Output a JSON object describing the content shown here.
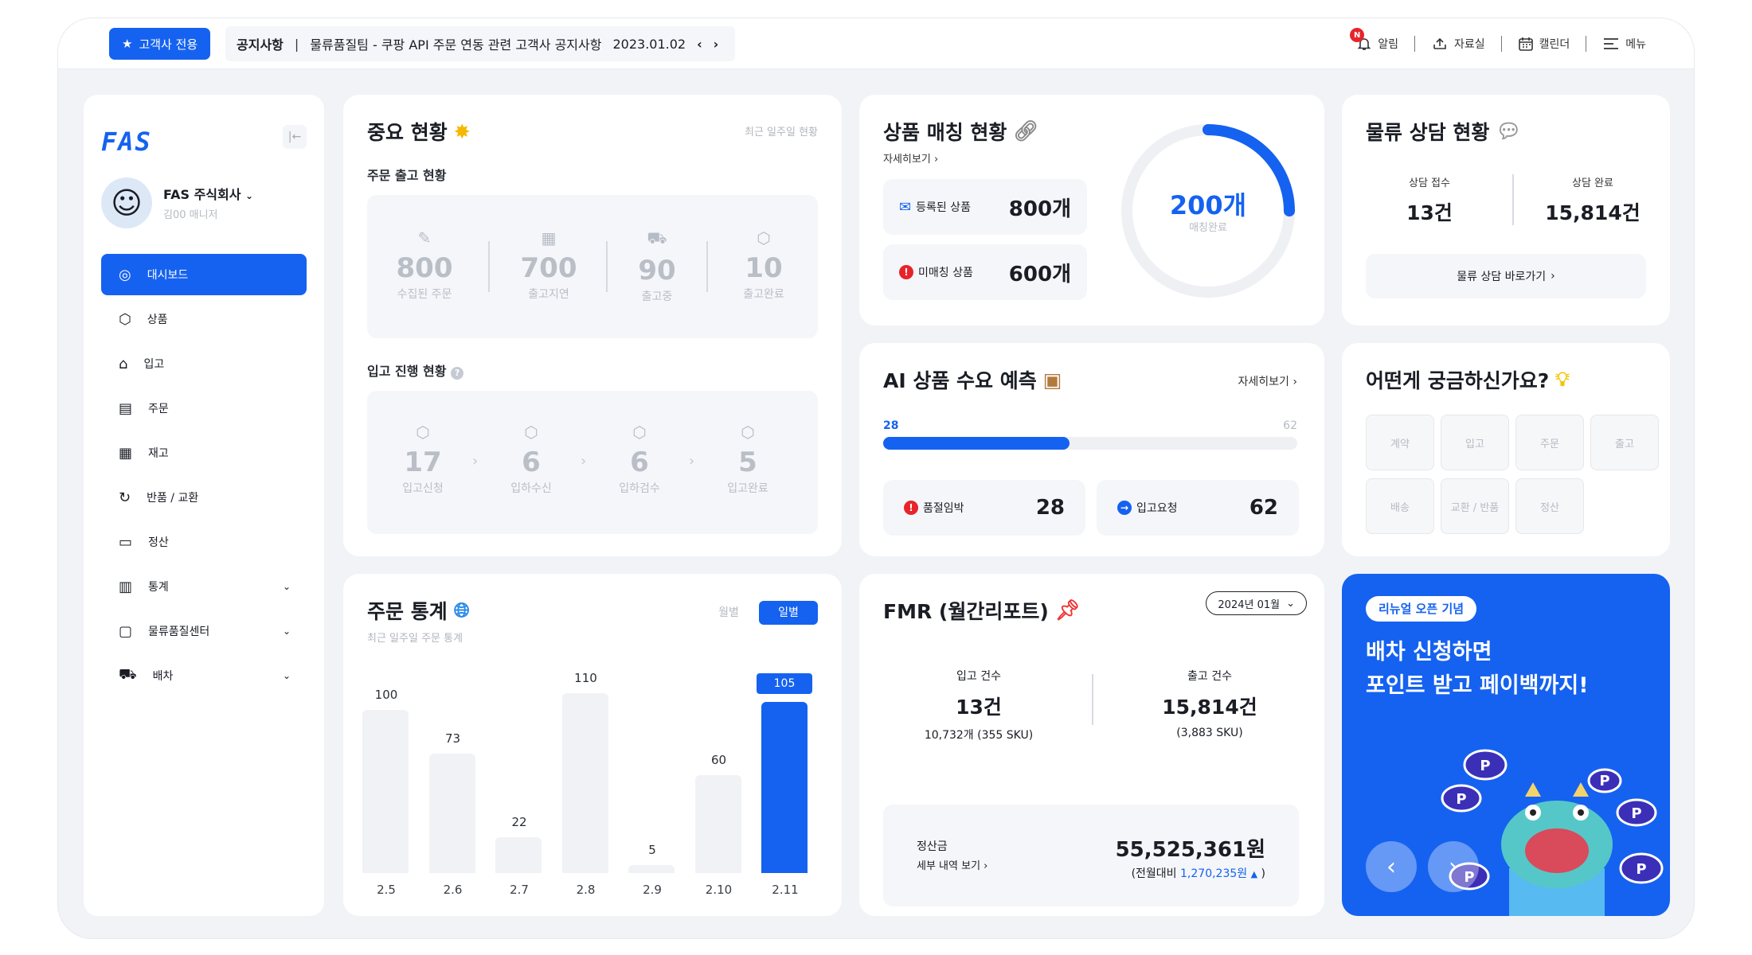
{
  "topbar": {
    "customer_badge": "고객사 전용",
    "notice_label": "공지사항",
    "notice_text": "물류품질팀 - 쿠팡 API 주문 연동 관련 고객사 공지사항",
    "notice_date": "2023.01.02",
    "notif_badge": "N",
    "items": {
      "alarm": "알림",
      "archive": "자료실",
      "calendar": "캘린더",
      "menu": "메뉴"
    }
  },
  "sidebar": {
    "logo": "FAS",
    "company": "FAS 주식회사",
    "user": "김00 매니저",
    "items": [
      {
        "label": "대시보드"
      },
      {
        "label": "상품"
      },
      {
        "label": "입고"
      },
      {
        "label": "주문"
      },
      {
        "label": "재고"
      },
      {
        "label": "반품 / 교환"
      },
      {
        "label": "정산"
      },
      {
        "label": "통계"
      },
      {
        "label": "물류품질센터"
      },
      {
        "label": "배차"
      }
    ]
  },
  "important": {
    "title": "중요 현황",
    "period": "최근 일주일 현황",
    "order_title": "주문 출고 현황",
    "orders": [
      {
        "value": "800",
        "label": "수집된 주문"
      },
      {
        "value": "700",
        "label": "출고지연"
      },
      {
        "value": "90",
        "label": "출고중"
      },
      {
        "value": "10",
        "label": "출고완료"
      }
    ],
    "inbound_title": "입고 진행 현황",
    "inbound": [
      {
        "value": "17",
        "label": "입고신청"
      },
      {
        "value": "6",
        "label": "입하수신"
      },
      {
        "value": "6",
        "label": "입하검수"
      },
      {
        "value": "5",
        "label": "입고완료"
      }
    ]
  },
  "matching": {
    "title": "상품 매칭 현황",
    "detail": "자세히보기",
    "registered_label": "등록된 상품",
    "registered_value": "800개",
    "unmatched_label": "미매칭 상품",
    "unmatched_value": "600개",
    "ring_value": "200개",
    "ring_label": "매칭완료",
    "ring_fraction": 0.25
  },
  "consult": {
    "title": "물류 상담 현황",
    "received_label": "상담 접수",
    "received_value": "13건",
    "done_label": "상담 완료",
    "done_value": "15,814건",
    "link": "물류 상담 바로가기"
  },
  "ai": {
    "title": "AI 상품 수요 예측",
    "detail": "자세히보기",
    "bar_left": "28",
    "bar_right": "62",
    "progress": 0.45,
    "soldout_label": "품절임박",
    "soldout_value": "28",
    "request_label": "입고요청",
    "request_value": "62"
  },
  "faq": {
    "title": "어떤게 궁금하신가요?",
    "buttons": [
      "계약",
      "입고",
      "주문",
      "출고",
      "배송",
      "교환 / 반품",
      "정산"
    ]
  },
  "order_stats": {
    "title": "주문 통계",
    "subtitle": "최근 일주일 주문 통계",
    "tab_monthly": "월별",
    "tab_daily": "일별"
  },
  "chart_data": {
    "type": "bar",
    "categories": [
      "2.5",
      "2.6",
      "2.7",
      "2.8",
      "2.9",
      "2.10",
      "2.11"
    ],
    "values": [
      100,
      73,
      22,
      110,
      5,
      60,
      105
    ],
    "highlight_index": 6,
    "ylim": [
      0,
      115
    ]
  },
  "fmr": {
    "title": "FMR (월간리포트)",
    "month": "2024년 01월",
    "in_label": "입고 건수",
    "in_value": "13건",
    "in_sub": "10,732개 (355 SKU)",
    "out_label": "출고 건수",
    "out_value": "15,814건",
    "out_sub": "(3,883 SKU)",
    "settle_label": "정산금",
    "settle_link": "세부 내역 보기",
    "settle_value": "55,525,361원",
    "compare_prefix": "(전월대비",
    "compare_value": "1,270,235원",
    "compare_suffix": ")"
  },
  "promo": {
    "badge": "리뉴얼 오픈 기념",
    "line1": "배차 신청하면",
    "line2": "포인트 받고 페이백까지!"
  },
  "colors": {
    "accent": "#1562f0",
    "danger": "#e8242b"
  }
}
